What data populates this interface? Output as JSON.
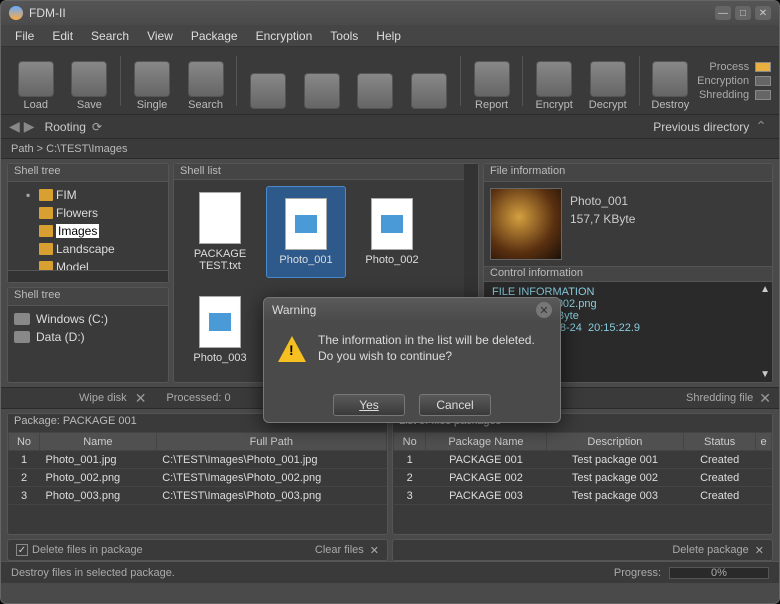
{
  "title": "FDM-II",
  "menu": [
    "File",
    "Edit",
    "Search",
    "View",
    "Package",
    "Encryption",
    "Tools",
    "Help"
  ],
  "toolbar": {
    "buttons": [
      "Load",
      "Save",
      "Single",
      "Search",
      "",
      "",
      "",
      "",
      "Report",
      "Encrypt",
      "Decrypt",
      "Destroy"
    ]
  },
  "flags": {
    "process": "Process",
    "encryption": "Encryption",
    "shredding": "Shredding"
  },
  "nav": {
    "rooting": "Rooting",
    "prev": "Previous directory"
  },
  "path": "Path  >  C:\\TEST\\Images",
  "shelltree": {
    "head": "Shell tree",
    "items": [
      "FIM",
      "Flowers",
      "Images",
      "Landscape",
      "Model"
    ]
  },
  "drives": {
    "head": "Shell tree",
    "items": [
      "Windows (C:)",
      "Data (D:)"
    ],
    "wipe": "Wipe disk"
  },
  "shelllist": {
    "head": "Shell list",
    "items": [
      {
        "name": "PACKAGE TEST.txt",
        "type": "txt"
      },
      {
        "name": "Photo_001",
        "type": "img",
        "sel": true
      },
      {
        "name": "Photo_002",
        "type": "img"
      },
      {
        "name": "Photo_003",
        "type": "img"
      }
    ],
    "processed": "Processed:  0"
  },
  "fileinfo": {
    "head": "File information",
    "name": "Photo_001",
    "size": "157,7 KByte",
    "ctrl_head": "Control information",
    "console": [
      "FILE INFORMATION",
      "",
      "le    :  Photo_002.png",
      "ze    :  33,8 KByte",
      "",
      "ate   :  2022-08-24  20:15:22.9"
    ],
    "shredding": "Shredding file"
  },
  "package_table": {
    "head": "Package:  PACKAGE 001",
    "cols": [
      "No",
      "Name",
      "Full Path"
    ],
    "rows": [
      [
        "1",
        "Photo_001.jpg",
        "C:\\TEST\\Images\\Photo_001.jpg"
      ],
      [
        "2",
        "Photo_002.png",
        "C:\\TEST\\Images\\Photo_002.png"
      ],
      [
        "3",
        "Photo_003.png",
        "C:\\TEST\\Images\\Photo_003.png"
      ]
    ],
    "check": "Delete files in package",
    "clear": "Clear files"
  },
  "list_table": {
    "head": "List of files packages",
    "cols": [
      "No",
      "Package Name",
      "Description",
      "Status",
      "e"
    ],
    "rows": [
      [
        "1",
        "PACKAGE 001",
        "Test package 001",
        "Created"
      ],
      [
        "2",
        "PACKAGE 002",
        "Test package 002",
        "Created"
      ],
      [
        "3",
        "PACKAGE 003",
        "Test package 003",
        "Created"
      ]
    ],
    "delete": "Delete package"
  },
  "status": {
    "msg": "Destroy files in selected package.",
    "progress_label": "Progress:",
    "progress_value": "0%"
  },
  "dialog": {
    "title": "Warning",
    "line1": "The information in the list will be deleted.",
    "line2": "Do you wish to continue?",
    "yes": "Yes",
    "cancel": "Cancel"
  }
}
